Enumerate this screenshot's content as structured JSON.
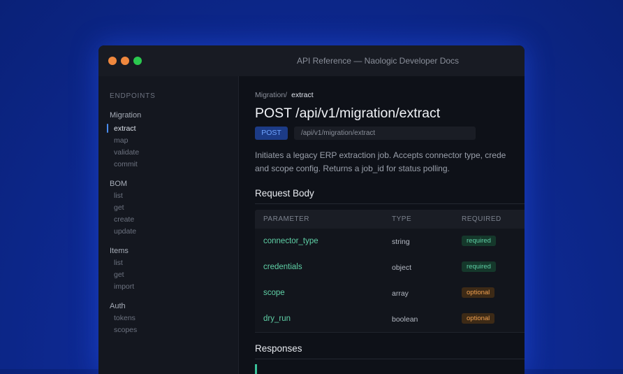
{
  "window": {
    "title": "API Reference — Naologic Developer Docs",
    "colors": {
      "close": "#f0883e",
      "minimize": "#f0883e",
      "maximize": "#2bc84f",
      "accent": "#4a8df0"
    }
  },
  "sidebar": {
    "heading": "ENDPOINTS",
    "groups": [
      {
        "title": "Migration",
        "items": [
          "extract",
          "map",
          "validate",
          "commit"
        ]
      },
      {
        "title": "BOM",
        "items": [
          "list",
          "get",
          "create",
          "update"
        ]
      },
      {
        "title": "Items",
        "items": [
          "list",
          "get",
          "import"
        ]
      },
      {
        "title": "Auth",
        "items": [
          "tokens",
          "scopes"
        ]
      }
    ],
    "active": "extract"
  },
  "main": {
    "breadcrumb": {
      "parent": "Migration/",
      "current": "extract"
    },
    "title": "POST /api/v1/migration/extract",
    "method": "POST",
    "path": "/api/v1/migration/extract",
    "description_line1": "Initiates a legacy ERP extraction job. Accepts connector type, crede",
    "description_line2": "and scope config. Returns a job_id for status polling.",
    "request_body": {
      "title": "Request Body",
      "headers": [
        "PARAMETER",
        "TYPE",
        "REQUIRED"
      ],
      "rows": [
        {
          "name": "connector_type",
          "type": "string",
          "required": "required"
        },
        {
          "name": "credentials",
          "type": "object",
          "required": "required"
        },
        {
          "name": "scope",
          "type": "array",
          "required": "optional"
        },
        {
          "name": "dry_run",
          "type": "boolean",
          "required": "optional"
        }
      ]
    },
    "responses": {
      "title": "Responses"
    }
  }
}
